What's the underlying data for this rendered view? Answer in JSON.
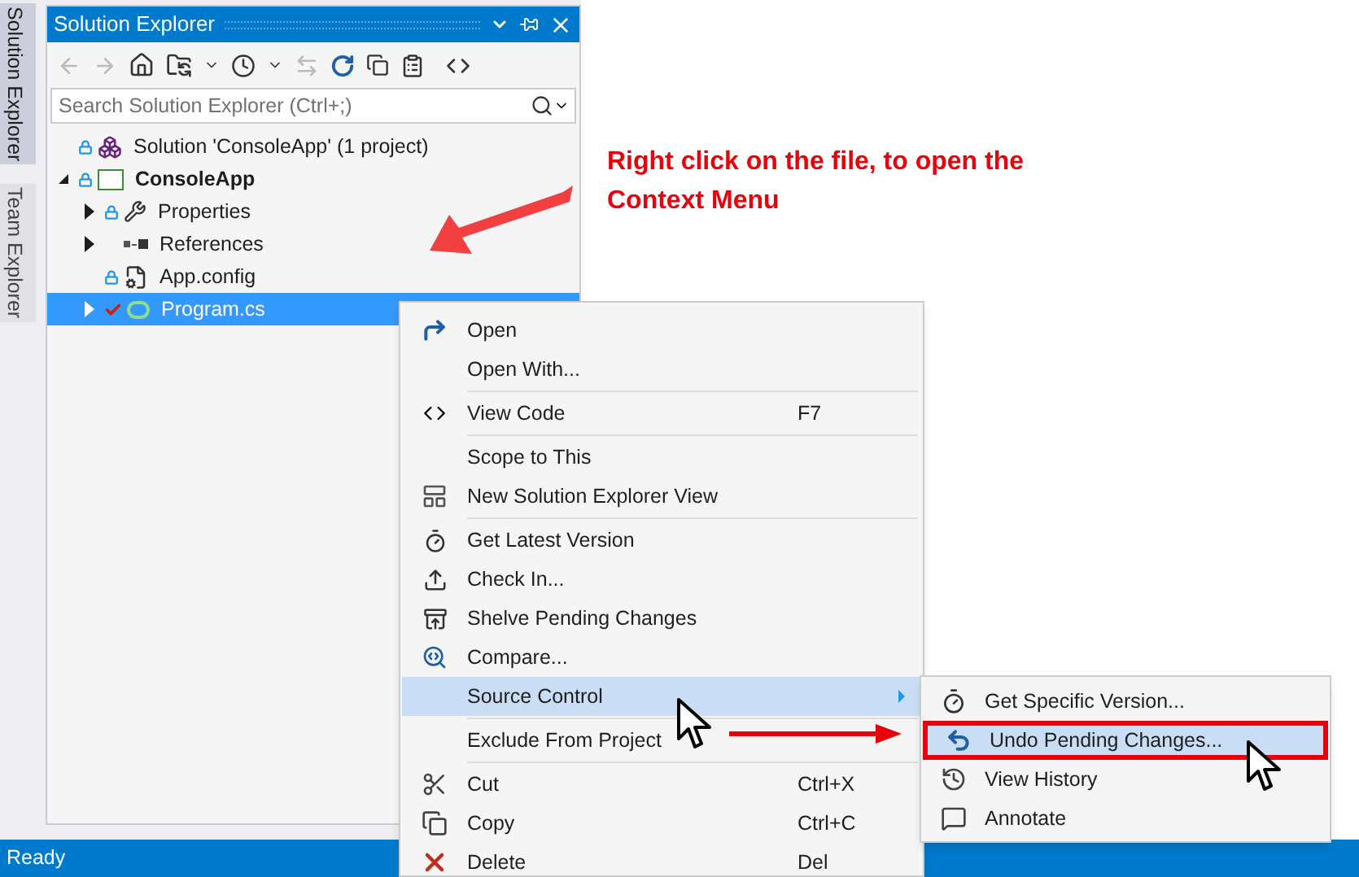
{
  "side_tabs": [
    {
      "label": "Solution Explorer",
      "selected": true
    },
    {
      "label": "Team Explorer",
      "selected": false
    }
  ],
  "panel": {
    "title": "Solution Explorer",
    "search": {
      "placeholder": "Search Solution Explorer (Ctrl+;)"
    },
    "tree": [
      {
        "label": "Solution 'ConsoleApp' (1 project)",
        "kind": "solution",
        "locked": true,
        "checked_out": false,
        "bold": false,
        "selected": false,
        "children": [
          {
            "label": "ConsoleApp",
            "kind": "project",
            "locked": true,
            "checked_out": false,
            "bold": true,
            "expanded": true,
            "selected": false,
            "children": [
              {
                "label": "Properties",
                "kind": "properties",
                "locked": true,
                "checked_out": false,
                "bold": false,
                "expanded": false,
                "selected": false
              },
              {
                "label": "References",
                "kind": "references",
                "locked": false,
                "checked_out": false,
                "bold": false,
                "expanded": false,
                "selected": false
              },
              {
                "label": "App.config",
                "kind": "config",
                "locked": true,
                "checked_out": false,
                "bold": false,
                "selected": false
              },
              {
                "label": "Program.cs",
                "kind": "csharp",
                "locked": false,
                "checked_out": true,
                "bold": false,
                "expanded": false,
                "selected": true
              }
            ]
          }
        ]
      }
    ]
  },
  "annotation": {
    "text": "Right click on the file, to open the Context Menu"
  },
  "context_menu": [
    {
      "kind": "item",
      "label": "Open",
      "selected": false
    },
    {
      "kind": "item",
      "label": "Open With...",
      "selected": false
    },
    {
      "kind": "separator"
    },
    {
      "kind": "item",
      "label": "View Code",
      "shortcut": "F7",
      "selected": false
    },
    {
      "kind": "separator"
    },
    {
      "kind": "item",
      "label": "Scope to This",
      "selected": false
    },
    {
      "kind": "item",
      "label": "New Solution Explorer View",
      "selected": false
    },
    {
      "kind": "separator"
    },
    {
      "kind": "item",
      "label": "Get Latest Version",
      "selected": false
    },
    {
      "kind": "item",
      "label": "Check In...",
      "selected": false
    },
    {
      "kind": "item",
      "label": "Shelve Pending Changes",
      "selected": false
    },
    {
      "kind": "item",
      "label": "Compare...",
      "selected": false
    },
    {
      "kind": "item",
      "label": "Source Control",
      "selected": true,
      "submenu": true
    },
    {
      "kind": "separator"
    },
    {
      "kind": "item",
      "label": "Exclude From Project",
      "selected": false
    },
    {
      "kind": "separator"
    },
    {
      "kind": "item",
      "label": "Cut",
      "shortcut": "Ctrl+X",
      "selected": false
    },
    {
      "kind": "item",
      "label": "Copy",
      "shortcut": "Ctrl+C",
      "selected": false
    },
    {
      "kind": "item",
      "label": "Delete",
      "shortcut": "Del",
      "selected": false
    }
  ],
  "submenu": [
    {
      "label": "Get Specific Version...",
      "selected": false,
      "outlined": false
    },
    {
      "label": "Undo Pending Changes...",
      "selected": true,
      "outlined": true
    },
    {
      "label": "View History",
      "selected": false,
      "outlined": false
    },
    {
      "label": "Annotate",
      "selected": false,
      "outlined": false
    }
  ],
  "status_bar": {
    "text": "Ready"
  }
}
